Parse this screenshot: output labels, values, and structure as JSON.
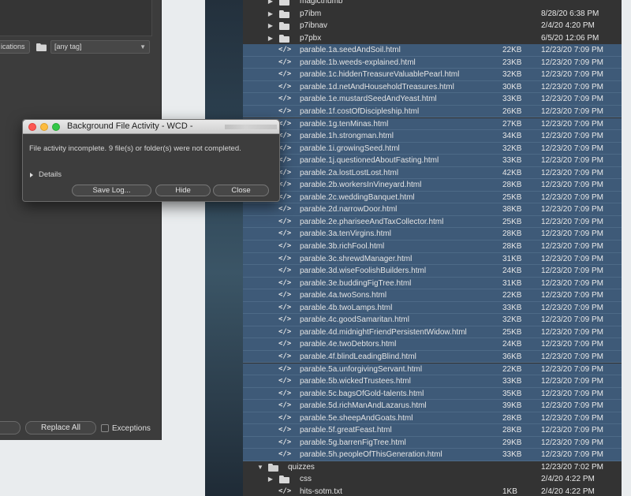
{
  "left_panel": {
    "filter_button_label": "ications",
    "tag_select_value": "[any tag]",
    "replace_all_label": "Replace All",
    "exceptions_label": "Exceptions"
  },
  "dialog": {
    "title": "Background File Activity - WCD - ",
    "message": "File activity incomplete. 9 file(s) or folder(s) were not completed.",
    "details_label": "Details",
    "save_log_label": "Save Log...",
    "hide_label": "Hide",
    "close_label": "Close"
  },
  "files": {
    "rows": [
      {
        "kind": "folder",
        "name": "magicthumb",
        "size": "",
        "date": "",
        "selected": false
      },
      {
        "kind": "folder",
        "name": "p7ibm",
        "size": "",
        "date": "8/28/20 6:38 PM",
        "selected": false
      },
      {
        "kind": "folder",
        "name": "p7ibnav",
        "size": "",
        "date": "2/4/20 4:20 PM",
        "selected": false
      },
      {
        "kind": "folder",
        "name": "p7pbx",
        "size": "",
        "date": "6/5/20 12:06 PM",
        "selected": false
      },
      {
        "kind": "html",
        "name": "parable.1a.seedAndSoil.html",
        "size": "22KB",
        "date": "12/23/20 7:09 PM",
        "selected": true
      },
      {
        "kind": "html",
        "name": "parable.1b.weeds-explained.html",
        "size": "23KB",
        "date": "12/23/20 7:09 PM",
        "selected": true
      },
      {
        "kind": "html",
        "name": "parable.1c.hiddenTreasureValuablePearl.html",
        "size": "32KB",
        "date": "12/23/20 7:09 PM",
        "selected": true
      },
      {
        "kind": "html",
        "name": "parable.1d.netAndHouseholdTreasures.html",
        "size": "30KB",
        "date": "12/23/20 7:09 PM",
        "selected": true
      },
      {
        "kind": "html",
        "name": "parable.1e.mustardSeedAndYeast.html",
        "size": "33KB",
        "date": "12/23/20 7:09 PM",
        "selected": true
      },
      {
        "kind": "html",
        "name": "parable.1f.costOfDiscipleship.html",
        "size": "26KB",
        "date": "12/23/20 7:09 PM",
        "selected": true
      },
      {
        "kind": "html",
        "name": "parable.1g.tenMinas.html",
        "size": "27KB",
        "date": "12/23/20 7:09 PM",
        "selected": true
      },
      {
        "kind": "html",
        "name": "parable.1h.strongman.html",
        "size": "34KB",
        "date": "12/23/20 7:09 PM",
        "selected": true
      },
      {
        "kind": "html",
        "name": "parable.1i.growingSeed.html",
        "size": "32KB",
        "date": "12/23/20 7:09 PM",
        "selected": true
      },
      {
        "kind": "html",
        "name": "parable.1j.questionedAboutFasting.html",
        "size": "33KB",
        "date": "12/23/20 7:09 PM",
        "selected": true
      },
      {
        "kind": "html",
        "name": "parable.2a.lostLostLost.html",
        "size": "42KB",
        "date": "12/23/20 7:09 PM",
        "selected": true
      },
      {
        "kind": "html",
        "name": "parable.2b.workersInVineyard.html",
        "size": "28KB",
        "date": "12/23/20 7:09 PM",
        "selected": true
      },
      {
        "kind": "html",
        "name": "parable.2c.weddingBanquet.html",
        "size": "25KB",
        "date": "12/23/20 7:09 PM",
        "selected": true
      },
      {
        "kind": "html",
        "name": "parable.2d.narrowDoor.html",
        "size": "38KB",
        "date": "12/23/20 7:09 PM",
        "selected": true
      },
      {
        "kind": "html",
        "name": "parable.2e.phariseeAndTaxCollector.html",
        "size": "25KB",
        "date": "12/23/20 7:09 PM",
        "selected": true
      },
      {
        "kind": "html",
        "name": "parable.3a.tenVirgins.html",
        "size": "28KB",
        "date": "12/23/20 7:09 PM",
        "selected": true
      },
      {
        "kind": "html",
        "name": "parable.3b.richFool.html",
        "size": "28KB",
        "date": "12/23/20 7:09 PM",
        "selected": true
      },
      {
        "kind": "html",
        "name": "parable.3c.shrewdManager.html",
        "size": "31KB",
        "date": "12/23/20 7:09 PM",
        "selected": true
      },
      {
        "kind": "html",
        "name": "parable.3d.wiseFoolishBuilders.html",
        "size": "24KB",
        "date": "12/23/20 7:09 PM",
        "selected": true
      },
      {
        "kind": "html",
        "name": "parable.3e.buddingFigTree.html",
        "size": "31KB",
        "date": "12/23/20 7:09 PM",
        "selected": true
      },
      {
        "kind": "html",
        "name": "parable.4a.twoSons.html",
        "size": "22KB",
        "date": "12/23/20 7:09 PM",
        "selected": true
      },
      {
        "kind": "html",
        "name": "parable.4b.twoLamps.html",
        "size": "33KB",
        "date": "12/23/20 7:09 PM",
        "selected": true
      },
      {
        "kind": "html",
        "name": "parable.4c.goodSamaritan.html",
        "size": "32KB",
        "date": "12/23/20 7:09 PM",
        "selected": true
      },
      {
        "kind": "html",
        "name": "parable.4d.midnightFriendPersistentWidow.html",
        "size": "25KB",
        "date": "12/23/20 7:09 PM",
        "selected": true
      },
      {
        "kind": "html",
        "name": "parable.4e.twoDebtors.html",
        "size": "24KB",
        "date": "12/23/20 7:09 PM",
        "selected": true
      },
      {
        "kind": "html",
        "name": "parable.4f.blindLeadingBlind.html",
        "size": "36KB",
        "date": "12/23/20 7:09 PM",
        "selected": true
      },
      {
        "kind": "html",
        "name": "parable.5a.unforgivingServant.html",
        "size": "22KB",
        "date": "12/23/20 7:09 PM",
        "selected": true
      },
      {
        "kind": "html",
        "name": "parable.5b.wickedTrustees.html",
        "size": "33KB",
        "date": "12/23/20 7:09 PM",
        "selected": true
      },
      {
        "kind": "html",
        "name": "parable.5c.bagsOfGold-talents.html",
        "size": "35KB",
        "date": "12/23/20 7:09 PM",
        "selected": true
      },
      {
        "kind": "html",
        "name": "parable.5d.richManAndLazarus.html",
        "size": "39KB",
        "date": "12/23/20 7:09 PM",
        "selected": true
      },
      {
        "kind": "html",
        "name": "parable.5e.sheepAndGoats.html",
        "size": "28KB",
        "date": "12/23/20 7:09 PM",
        "selected": true
      },
      {
        "kind": "html",
        "name": "parable.5f.greatFeast.html",
        "size": "28KB",
        "date": "12/23/20 7:09 PM",
        "selected": true
      },
      {
        "kind": "html",
        "name": "parable.5g.barrenFigTree.html",
        "size": "29KB",
        "date": "12/23/20 7:09 PM",
        "selected": true
      },
      {
        "kind": "html",
        "name": "parable.5h.peopleOfThisGeneration.html",
        "size": "33KB",
        "date": "12/23/20 7:09 PM",
        "selected": true
      },
      {
        "kind": "folder-open",
        "name": "quizzes",
        "size": "",
        "date": "12/23/20 7:02 PM",
        "selected": false
      },
      {
        "kind": "subfolder",
        "name": "css",
        "size": "",
        "date": "2/4/20 4:22 PM",
        "selected": false
      },
      {
        "kind": "subhtml",
        "name": "hits-sotm.txt",
        "size": "1KB",
        "date": "2/4/20 4:22 PM",
        "selected": false
      }
    ]
  },
  "colors": {
    "selection": "#3e5a78",
    "panel": "#333333",
    "close_button": "#fc5753",
    "minimize_button": "#fdbc40",
    "zoom_button": "#33c748"
  }
}
